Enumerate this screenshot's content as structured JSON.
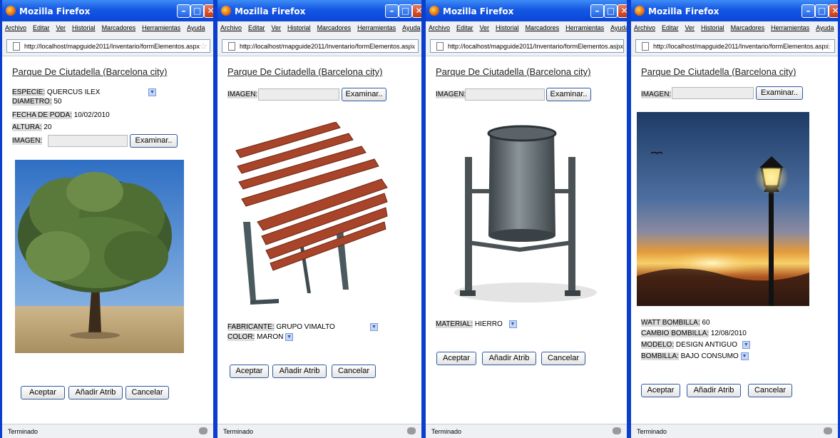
{
  "browser": {
    "title": "Mozilla Firefox",
    "menu": [
      "Archivo",
      "Editar",
      "Ver",
      "Historial",
      "Marcadores",
      "Herramientas",
      "Ayuda"
    ],
    "url": "http://localhost/mapguide2011/Inventario/formElementos.aspx",
    "status": "Terminado"
  },
  "page_title": "Parque De Ciutadella (Barcelona  city)",
  "buttons": {
    "accept": "Aceptar",
    "add": "Añadir Atrib",
    "cancel": "Cancelar",
    "browse": "Examinar.."
  },
  "image_label": "IMAGEN:",
  "tree": {
    "especie_label": "ESPECIE:",
    "especie_value": "QUERCUS ILEX",
    "diametro_label": "DIAMETRO:",
    "diametro_value": "50",
    "fecha_label": "FECHA DE PODA:",
    "fecha_value": "10/02/2010",
    "altura_label": "ALTURA:",
    "altura_value": "20"
  },
  "bench": {
    "fabricante_label": "FABRICANTE:",
    "fabricante_value": "GRUPO VIMALTO",
    "color_label": "COLOR:",
    "color_value": "MARON"
  },
  "bin": {
    "material_label": "MATERIAL:",
    "material_value": "HIERRO"
  },
  "lamp": {
    "watt_label": "WATT BOMBILLA:",
    "watt_value": "60",
    "cambio_label": "CAMBIO BOMBILLA:",
    "cambio_value": "12/08/2010",
    "modelo_label": "MODELO:",
    "modelo_value": "DESIGN ANTIGUO",
    "bombilla_label": "BOMBILLA:",
    "bombilla_value": "BAJO CONSUMO"
  },
  "colors": {
    "titlebar": "#1557e3",
    "frame": "#0a3ecf"
  }
}
